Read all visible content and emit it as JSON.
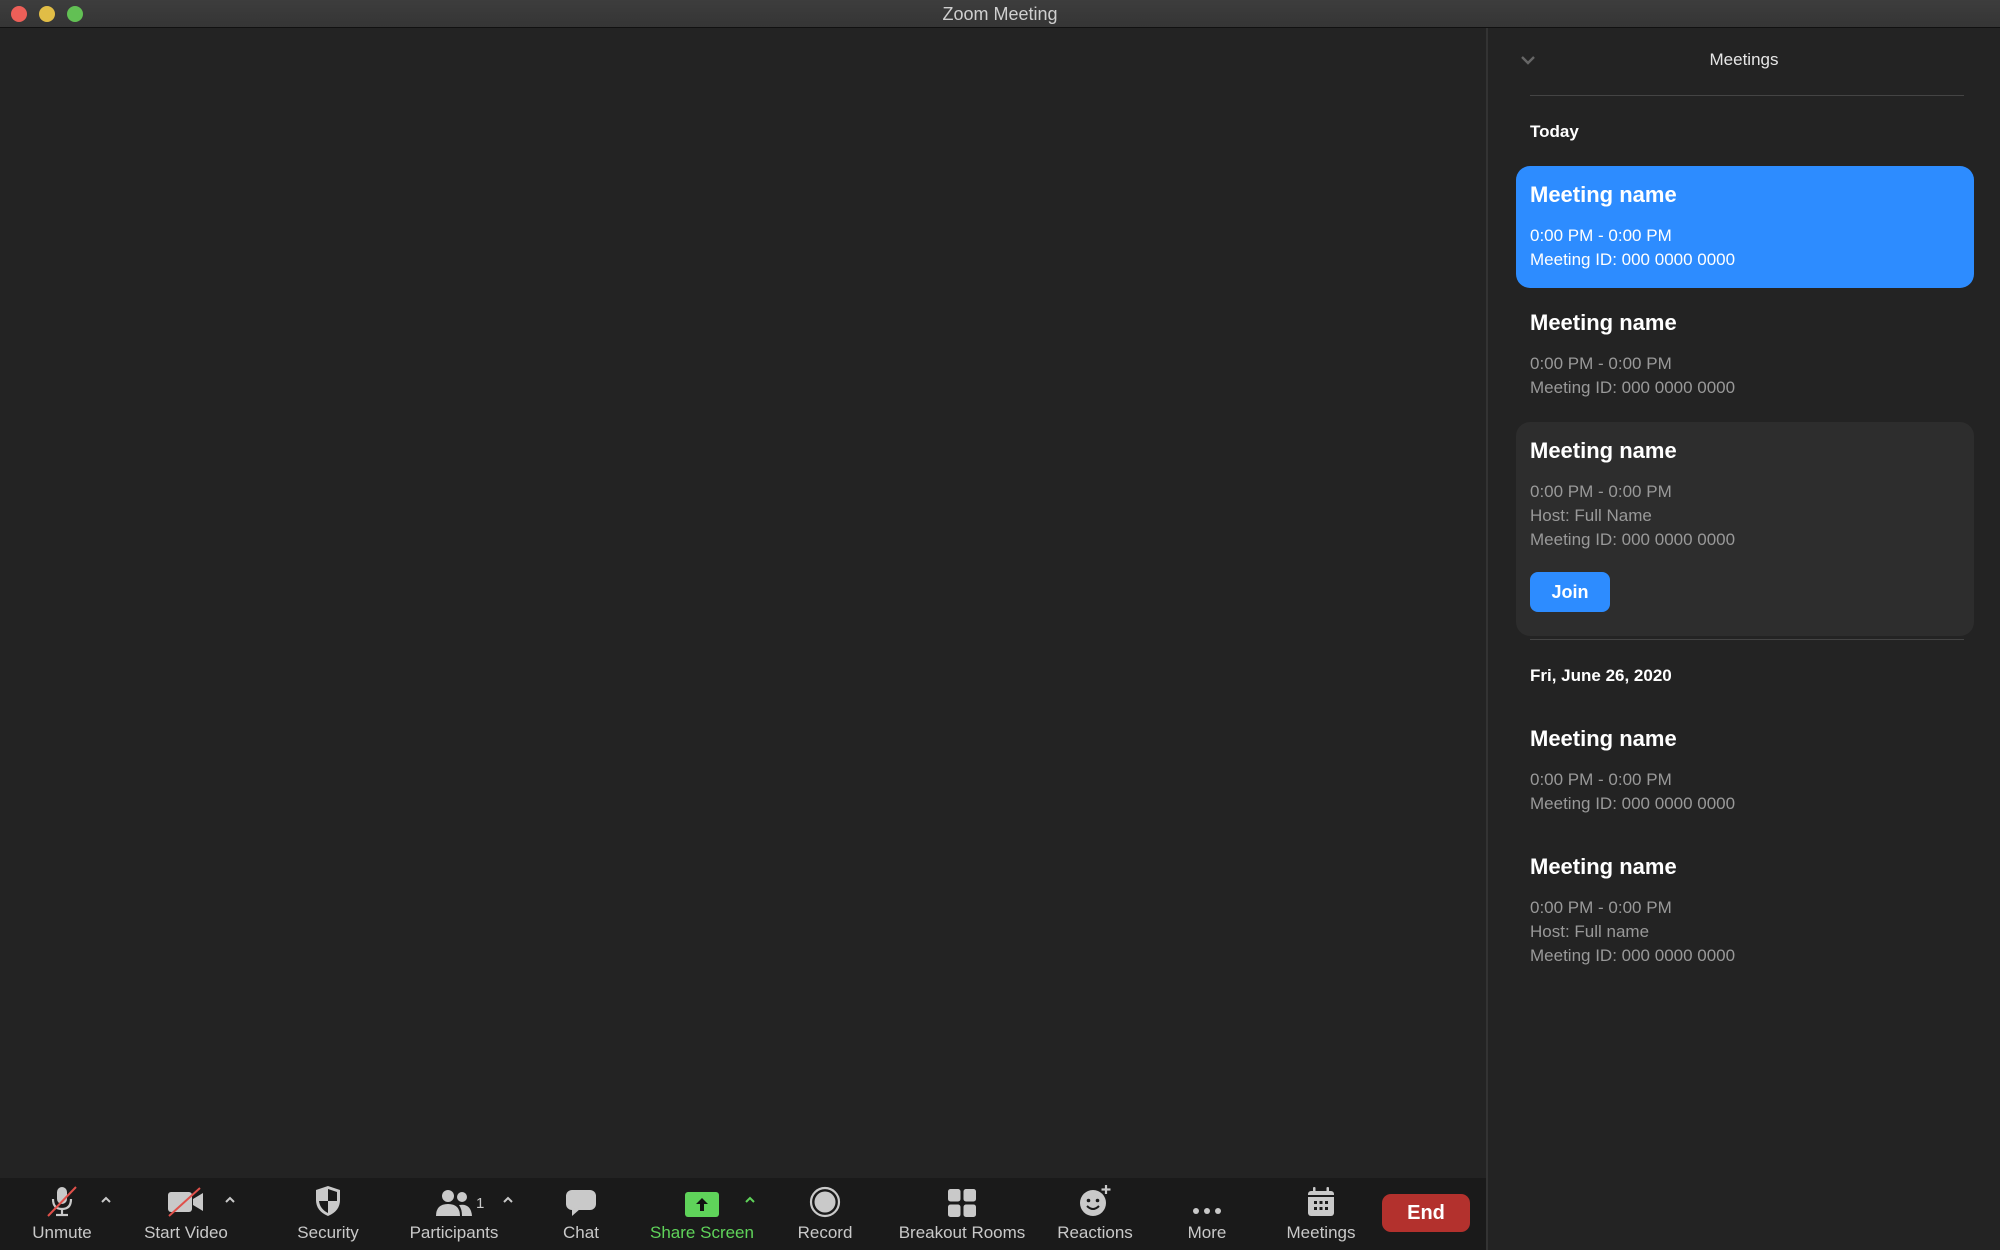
{
  "window": {
    "title": "Zoom Meeting"
  },
  "panel": {
    "title": "Meetings",
    "sections": [
      {
        "label": "Today",
        "meetings": [
          {
            "name": "Meeting name",
            "time": "0:00 PM - 0:00 PM",
            "id": "Meeting ID: 000 0000 0000",
            "state": "selected"
          },
          {
            "name": "Meeting name",
            "time": "0:00 PM - 0:00 PM",
            "id": "Meeting ID: 000 0000 0000",
            "state": "normal"
          },
          {
            "name": "Meeting name",
            "time": "0:00 PM - 0:00 PM",
            "host": "Host: Full Name",
            "id": "Meeting ID: 000 0000 0000",
            "state": "hover",
            "join_label": "Join"
          }
        ]
      },
      {
        "label": "Fri, June 26, 2020",
        "meetings": [
          {
            "name": "Meeting name",
            "time": "0:00 PM - 0:00 PM",
            "id": "Meeting ID: 000 0000 0000",
            "state": "normal"
          },
          {
            "name": "Meeting name",
            "time": "0:00 PM - 0:00 PM",
            "host": "Host: Full name",
            "id": "Meeting ID: 000 0000 0000",
            "state": "normal"
          }
        ]
      }
    ]
  },
  "toolbar": {
    "unmute": "Unmute",
    "start_video": "Start Video",
    "security": "Security",
    "participants": "Participants",
    "participants_count": "1",
    "chat": "Chat",
    "share_screen": "Share Screen",
    "record": "Record",
    "breakout_rooms": "Breakout Rooms",
    "reactions": "Reactions",
    "more": "More",
    "meetings": "Meetings",
    "end": "End"
  },
  "colors": {
    "accent_blue": "#2d8cff",
    "share_green": "#5fd35a",
    "end_red": "#b3312d",
    "muted_slash": "#e0504a"
  }
}
